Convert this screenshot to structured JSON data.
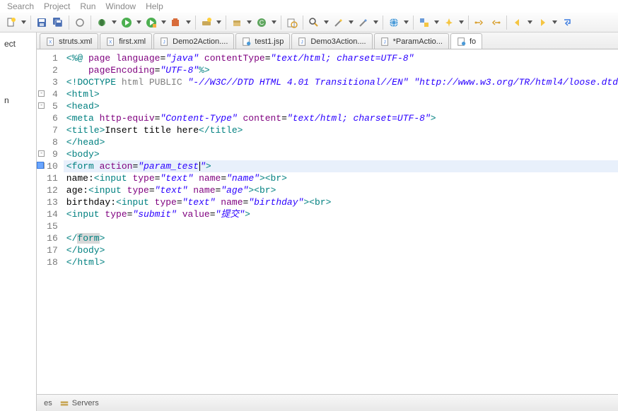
{
  "menu": {
    "items": [
      "Search",
      "Project",
      "Run",
      "Window",
      "Help"
    ]
  },
  "sidebar": {
    "items": [
      "ect",
      "n"
    ]
  },
  "tabs": [
    {
      "label": "struts.xml",
      "icon": "xml"
    },
    {
      "label": "first.xml",
      "icon": "xml"
    },
    {
      "label": "Demo2Action....",
      "icon": "java"
    },
    {
      "label": "test1.jsp",
      "icon": "jsp"
    },
    {
      "label": "Demo3Action....",
      "icon": "java"
    },
    {
      "label": "*ParamActio...",
      "icon": "java"
    },
    {
      "label": "fo",
      "icon": "jsp",
      "active": true
    }
  ],
  "code": {
    "lines": [
      {
        "n": 1,
        "html": "<span class='tagbr'>&lt;%@</span> <span class='attr'>page</span> <span class='attr'>language</span>=<span class='str'>\"java\"</span> <span class='attr'>contentType</span>=<span class='str'>\"text/html; charset=UTF-8\"</span>"
      },
      {
        "n": 2,
        "html": "    <span class='attr'>pageEncoding</span>=<span class='str'>\"UTF-8\"</span><span class='tagbr'>%&gt;</span>"
      },
      {
        "n": 3,
        "html": "<span class='doctype'>&lt;!DOCTYPE</span> <span class='doctype-kw'>html</span> <span class='doctype-kw'>PUBLIC</span> <span class='str'>\"-//W3C//DTD HTML 4.01 Transitional//EN\"</span> <span class='str'>\"http://www.w3.org/TR/html4/loose.dtd</span>"
      },
      {
        "n": 4,
        "fold": "-",
        "html": "<span class='tagbr'>&lt;</span><span class='tagc'>html</span><span class='tagbr'>&gt;</span>"
      },
      {
        "n": 5,
        "fold": "-",
        "html": "<span class='tagbr'>&lt;</span><span class='tagc'>head</span><span class='tagbr'>&gt;</span>"
      },
      {
        "n": 6,
        "html": "<span class='tagbr'>&lt;</span><span class='tagc'>meta</span> <span class='attr'>http-equiv</span>=<span class='str'>\"Content-Type\"</span> <span class='attr'>content</span>=<span class='str'>\"text/html; charset=UTF-8\"</span><span class='tagbr'>&gt;</span>"
      },
      {
        "n": 7,
        "html": "<span class='tagbr'>&lt;</span><span class='tagc'>title</span><span class='tagbr'>&gt;</span><span class='txt'>Insert title here</span><span class='tagbr'>&lt;/</span><span class='tagc'>title</span><span class='tagbr'>&gt;</span>"
      },
      {
        "n": 8,
        "html": "<span class='tagbr'>&lt;/</span><span class='tagc'>head</span><span class='tagbr'>&gt;</span>"
      },
      {
        "n": 9,
        "fold": "-",
        "html": "<span class='tagbr'>&lt;</span><span class='tagc'>body</span><span class='tagbr'>&gt;</span>"
      },
      {
        "n": 10,
        "fold": "-",
        "hl": true,
        "marker": true,
        "html": "<span class='tagbr'>&lt;</span><span class='tagc'>form</span> <span class='attr'>action</span>=<span class='str'>\"param_test</span><span class='caret'></span><span class='str'>\"</span><span class='tagbr'>&gt;</span>"
      },
      {
        "n": 11,
        "html": "<span class='txt'>name:</span><span class='tagbr'>&lt;</span><span class='tagc'>input</span> <span class='attr'>type</span>=<span class='str'>\"text\"</span> <span class='attr'>name</span>=<span class='str'>\"name\"</span><span class='tagbr'>&gt;&lt;</span><span class='tagc'>br</span><span class='tagbr'>&gt;</span>"
      },
      {
        "n": 12,
        "html": "<span class='txt'>age:</span><span class='tagbr'>&lt;</span><span class='tagc'>input</span> <span class='attr'>type</span>=<span class='str'>\"text\"</span> <span class='attr'>name</span>=<span class='str'>\"age\"</span><span class='tagbr'>&gt;&lt;</span><span class='tagc'>br</span><span class='tagbr'>&gt;</span>"
      },
      {
        "n": 13,
        "html": "<span class='txt'>birthday:</span><span class='tagbr'>&lt;</span><span class='tagc'>input</span> <span class='attr'>type</span>=<span class='str'>\"text\"</span> <span class='attr'>name</span>=<span class='str'>\"birthday\"</span><span class='tagbr'>&gt;&lt;</span><span class='tagc'>br</span><span class='tagbr'>&gt;</span>"
      },
      {
        "n": 14,
        "html": "<span class='tagbr'>&lt;</span><span class='tagc'>input</span> <span class='attr'>type</span>=<span class='str'>\"submit\"</span> <span class='attr'>value</span>=<span class='str'>\"提交\"</span><span class='tagbr'>&gt;</span>"
      },
      {
        "n": 15,
        "html": ""
      },
      {
        "n": 16,
        "html": "<span class='tagbr'>&lt;/</span><span style='background:#d8d8d8' class='tagc'>form</span><span class='tagbr'>&gt;</span>"
      },
      {
        "n": 17,
        "html": "<span class='tagbr'>&lt;/</span><span class='tagc'>body</span><span class='tagbr'>&gt;</span>"
      },
      {
        "n": 18,
        "html": "<span class='tagbr'>&lt;/</span><span class='tagc'>html</span><span class='tagbr'>&gt;</span>"
      }
    ]
  },
  "bottom": {
    "tabs": [
      "es",
      "Servers"
    ]
  }
}
